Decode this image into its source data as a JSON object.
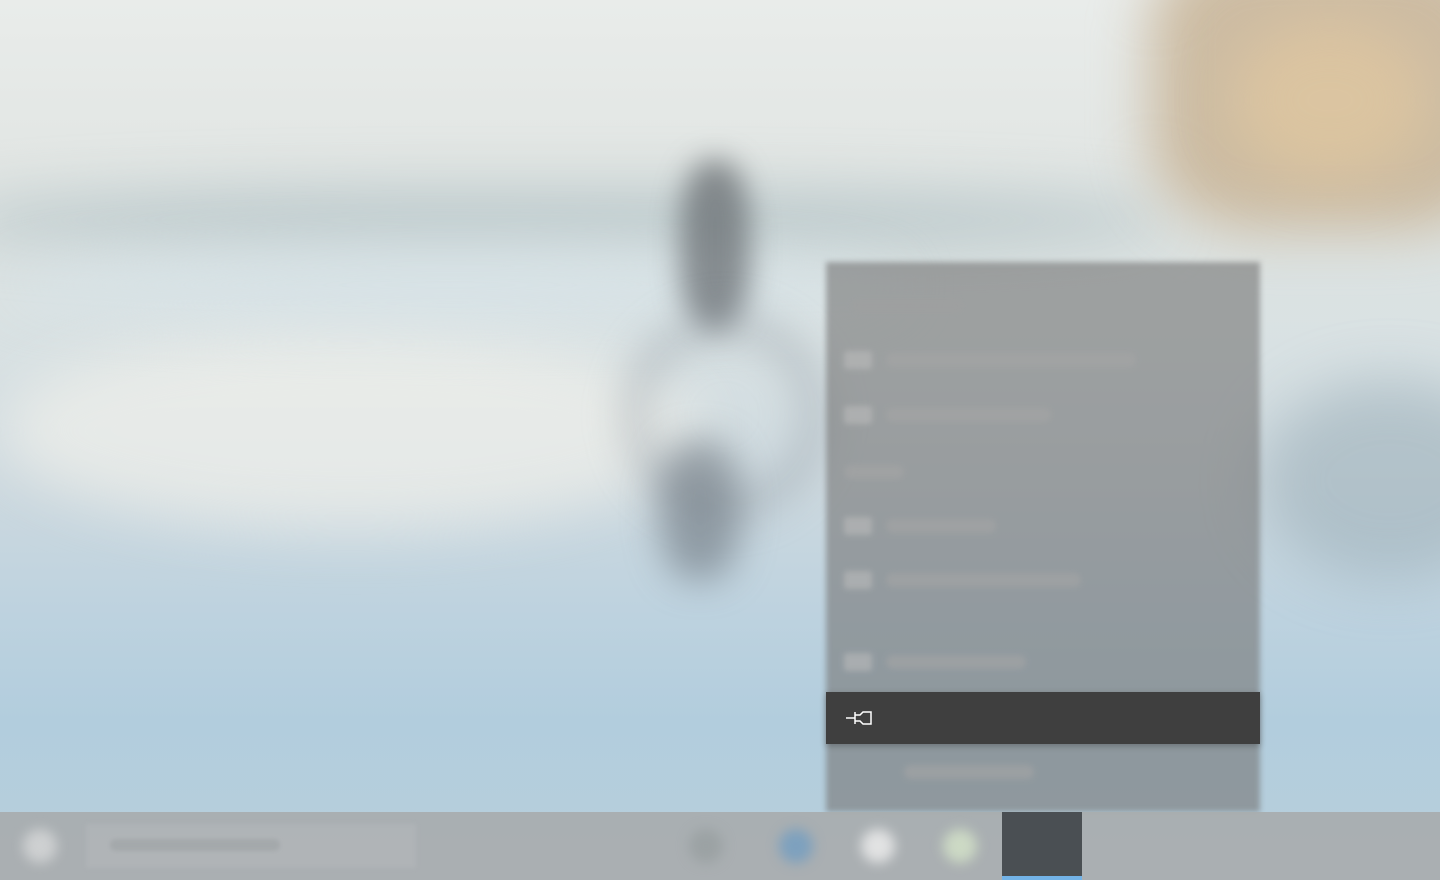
{
  "window": {
    "title": ""
  },
  "jump_list": {
    "pin_item": {
      "label": "",
      "icon": "pin-icon"
    }
  },
  "taskbar": {
    "search": {
      "placeholder": ""
    },
    "apps": [
      {
        "name": "task-view-button",
        "icon": "task-view-icon"
      },
      {
        "name": "edge-button",
        "icon": "edge-icon"
      },
      {
        "name": "explorer-button",
        "icon": "folder-icon"
      },
      {
        "name": "store-button",
        "icon": "store-icon"
      },
      {
        "name": "active-app-button",
        "icon": "app-icon",
        "active": true
      }
    ]
  },
  "colors": {
    "menu_item_bg": "#3f3f3f",
    "active_indicator": "#73b3e7",
    "taskbar_bg": "#a8acae"
  }
}
